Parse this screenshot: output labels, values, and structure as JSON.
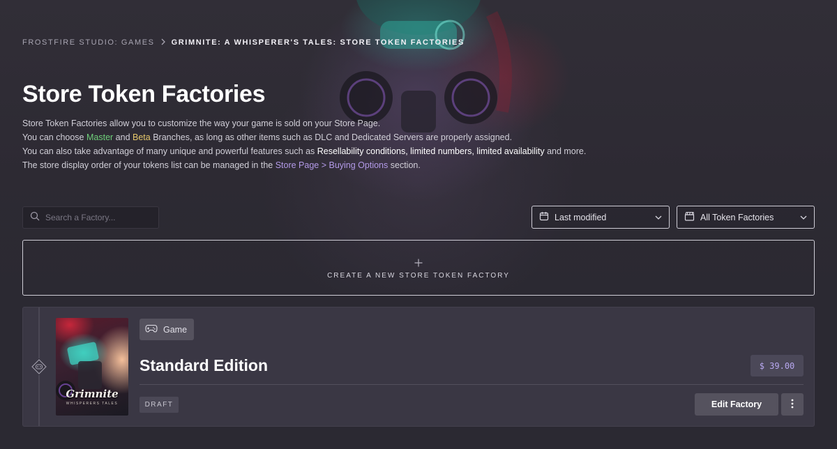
{
  "breadcrumb": {
    "studio": "FROSTFIRE STUDIO: GAMES",
    "current": "GRIMNITE: A WHISPERER'S TALES: STORE TOKEN FACTORIES"
  },
  "page": {
    "title": "Store Token Factories",
    "line1": "Store Token Factories allow you to customize the way your game is sold on your Store Page.",
    "line2_pre": "You can choose ",
    "line2_master": "Master",
    "line2_and": " and ",
    "line2_beta": "Beta",
    "line2_post": " Branches, as long as other items such as DLC and Dedicated Servers are properly assigned.",
    "line3_pre": "You can also take advantage of many unique and powerful features such as ",
    "line3_features": "Resellability conditions, limited numbers, limited availability",
    "line3_post": " and more.",
    "line4_pre": "The store display order of your tokens list can be managed in the ",
    "line4_link": "Store Page > Buying Options",
    "line4_post": " section."
  },
  "search": {
    "placeholder": "Search a Factory..."
  },
  "sort": {
    "selected": "Last modified"
  },
  "filter": {
    "selected": "All Token Factories"
  },
  "create": {
    "label": "CREATE A NEW STORE TOKEN FACTORY"
  },
  "factories": [
    {
      "type": "Game",
      "title": "Standard Edition",
      "price": "$ 39.00",
      "status": "DRAFT",
      "cover_title": "Grimnite",
      "cover_subtitle": "WHISPERERS TALES",
      "edit_label": "Edit Factory"
    }
  ],
  "colors": {
    "background": "#2b2932",
    "card": "#3a3744",
    "master": "#6fcf7a",
    "beta": "#e5c76b",
    "link": "#b39ae8",
    "price": "#b8a8f0"
  }
}
